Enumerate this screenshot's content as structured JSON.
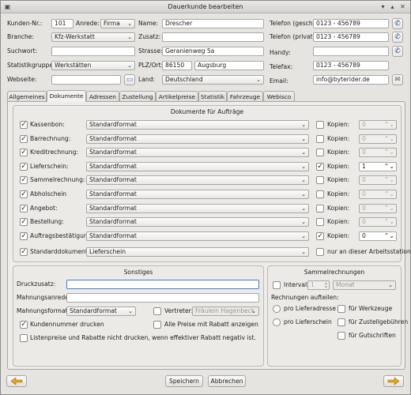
{
  "window": {
    "title": "Dauerkunde bearbeiten",
    "min_glyph": "▾",
    "max_glyph": "▴",
    "close_glyph": "✕"
  },
  "head": {
    "kundennr_label": "Kunden-Nr.:",
    "kundennr": "101",
    "anrede_label": "Anrede:",
    "anrede": "Firma",
    "branche_label": "Branche:",
    "branche": "Kfz-Werkstatt",
    "suchwort_label": "Suchwort:",
    "suchwort": "",
    "statistikgruppe_label": "Statistikgruppe:",
    "statistikgruppe": "Werkstätten",
    "webseite_label": "Webseite:",
    "webseite": "",
    "name_label": "Name:",
    "name": "Drescher",
    "zusatz_label": "Zusatz:",
    "zusatz": "",
    "strasse_label": "Strasse:",
    "strasse": "Geranienweg 5a",
    "plzort_label": "PLZ/Ort:",
    "plz": "86150",
    "ort": "Augsburg",
    "land_label": "Land:",
    "land": "Deutschland",
    "tel_gesch_label": "Telefon (gesch.):",
    "tel_gesch": "0123 - 456789",
    "tel_privat_label": "Telefon (privat):",
    "tel_privat": "0123 - 456789",
    "handy_label": "Handy:",
    "handy": "",
    "telefax_label": "Telefax:",
    "telefax": "0123 - 456789",
    "email_label": "Email:",
    "email": "info@byterider.de"
  },
  "tabs": [
    "Allgemeines",
    "Dokumente",
    "Adressen",
    "Zustellung",
    "Artikelpreise",
    "Statistik",
    "Fahrzeuge",
    "Webisco"
  ],
  "active_tab": "Dokumente",
  "documents": {
    "title": "Dokumente für Aufträge",
    "kopien_label": "Kopien:",
    "rows": [
      {
        "label": "Kassenbon:",
        "checked": true,
        "format": "Standardformat",
        "kopien_checked": false,
        "kopien": "0"
      },
      {
        "label": "Barrechnung:",
        "checked": true,
        "format": "Standardformat",
        "kopien_checked": false,
        "kopien": "0"
      },
      {
        "label": "Kreditrechnung:",
        "checked": true,
        "format": "Standardformat",
        "kopien_checked": false,
        "kopien": "0"
      },
      {
        "label": "Lieferschein:",
        "checked": true,
        "format": "Standardformat",
        "kopien_checked": true,
        "kopien": "1"
      },
      {
        "label": "Sammelrechnung:",
        "checked": true,
        "format": "Standardformat",
        "kopien_checked": false,
        "kopien": "0"
      },
      {
        "label": "Abholschein",
        "checked": true,
        "format": "Standardformat",
        "kopien_checked": false,
        "kopien": "0"
      },
      {
        "label": "Angebot:",
        "checked": true,
        "format": "Standardformat",
        "kopien_checked": false,
        "kopien": "0"
      },
      {
        "label": "Bestellung:",
        "checked": true,
        "format": "Standardformat",
        "kopien_checked": false,
        "kopien": "0"
      },
      {
        "label": "Auftragsbestätigung:",
        "checked": true,
        "format": "Standardformat",
        "kopien_checked": true,
        "kopien": "0"
      }
    ],
    "standard_label": "Standarddokument:",
    "standard_value": "Lieferschein",
    "station_label": "nur an dieser Arbeitsstation"
  },
  "sonstiges": {
    "title": "Sonstiges",
    "druckzusatz_label": "Druckzusatz:",
    "druckzusatz": "",
    "mahnungsanrede_label": "Mahnungsanrede:",
    "mahnungsanrede": "",
    "mahnungsformat_label": "Mahnungsformat:",
    "mahnungsformat": "Standardformat",
    "vertreter_label": "Vertreter:",
    "vertreter": "Fräulein Hagenbeck",
    "kundennummer_label": "Kundennummer drucken",
    "rabatt_label": "Alle Preise mit Rabatt anzeigen",
    "listenpreise_label": "Listenpreise und Rabatte nicht drucken, wenn effektiver Rabatt negativ ist."
  },
  "sammel": {
    "title": "Sammelrechnungen",
    "intervall_label": "Intervall:",
    "intervall_num": "1",
    "intervall_unit": "Monat",
    "aufteilen_label": "Rechnungen aufteilen:",
    "lieferadresse": "pro Lieferadresse",
    "lieferschein": "pro Lieferschein",
    "werkzeuge": "für Werkzeuge",
    "zustellgebuehren": "für Zustellgebühren",
    "gutschriften": "für Gutschriften"
  },
  "footer": {
    "save": "Speichern",
    "cancel": "Abbrechen"
  },
  "colors": {
    "accent": "#3d7fd6",
    "arrow": "#e8a11c"
  }
}
